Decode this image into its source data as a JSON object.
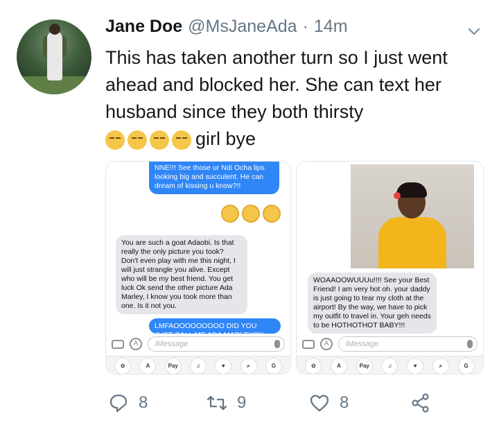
{
  "tweet": {
    "name": "Jane Doe",
    "handle": "@MsJaneAda",
    "dot": "·",
    "time": "14m",
    "text": "This has taken another turn so I just went ahead and blocked her. She can text her husband since they both thirsty",
    "text_tail": "girl bye"
  },
  "left_screenshot": {
    "msg1": "NNE!!! See those ur Ndi Ocha lips looking big and succulent. He can dream of kissing u know?!!",
    "msg2": "You are such a goat Adaobi. Is that really the only picture you took? Don't even play with me this night, I will just strangle you alive. Except who will be my best friend. You get luck Ok send the other picture Ada Marley, I know you took more than one. Is it not you.",
    "msg3": "LMFAOOOOOOOOO DID YOU JUST CALL ME ADA MARLEY?!!! Like BOB",
    "placeholder": "iMessage"
  },
  "right_screenshot": {
    "msg1": "WOAAOOWUUUu!!!! See your Best Friend! I am very hot oh. your daddy is just going to tear my cloth at the airport! By the way, we have to pick my outfit to travel in. Your geh needs to be HOTHOTHOT BABY!!!",
    "placeholder": "iMessage"
  },
  "app_strip": [
    "✿",
    "A",
    "Pay",
    "♫",
    "♥",
    "⌕",
    "G"
  ],
  "actions": {
    "replies": "8",
    "retweets": "9",
    "likes": "8"
  },
  "colors": {
    "imessage_blue": "#2f86f6",
    "bubble_gray": "#e6e6ea",
    "muted": "#657786"
  }
}
